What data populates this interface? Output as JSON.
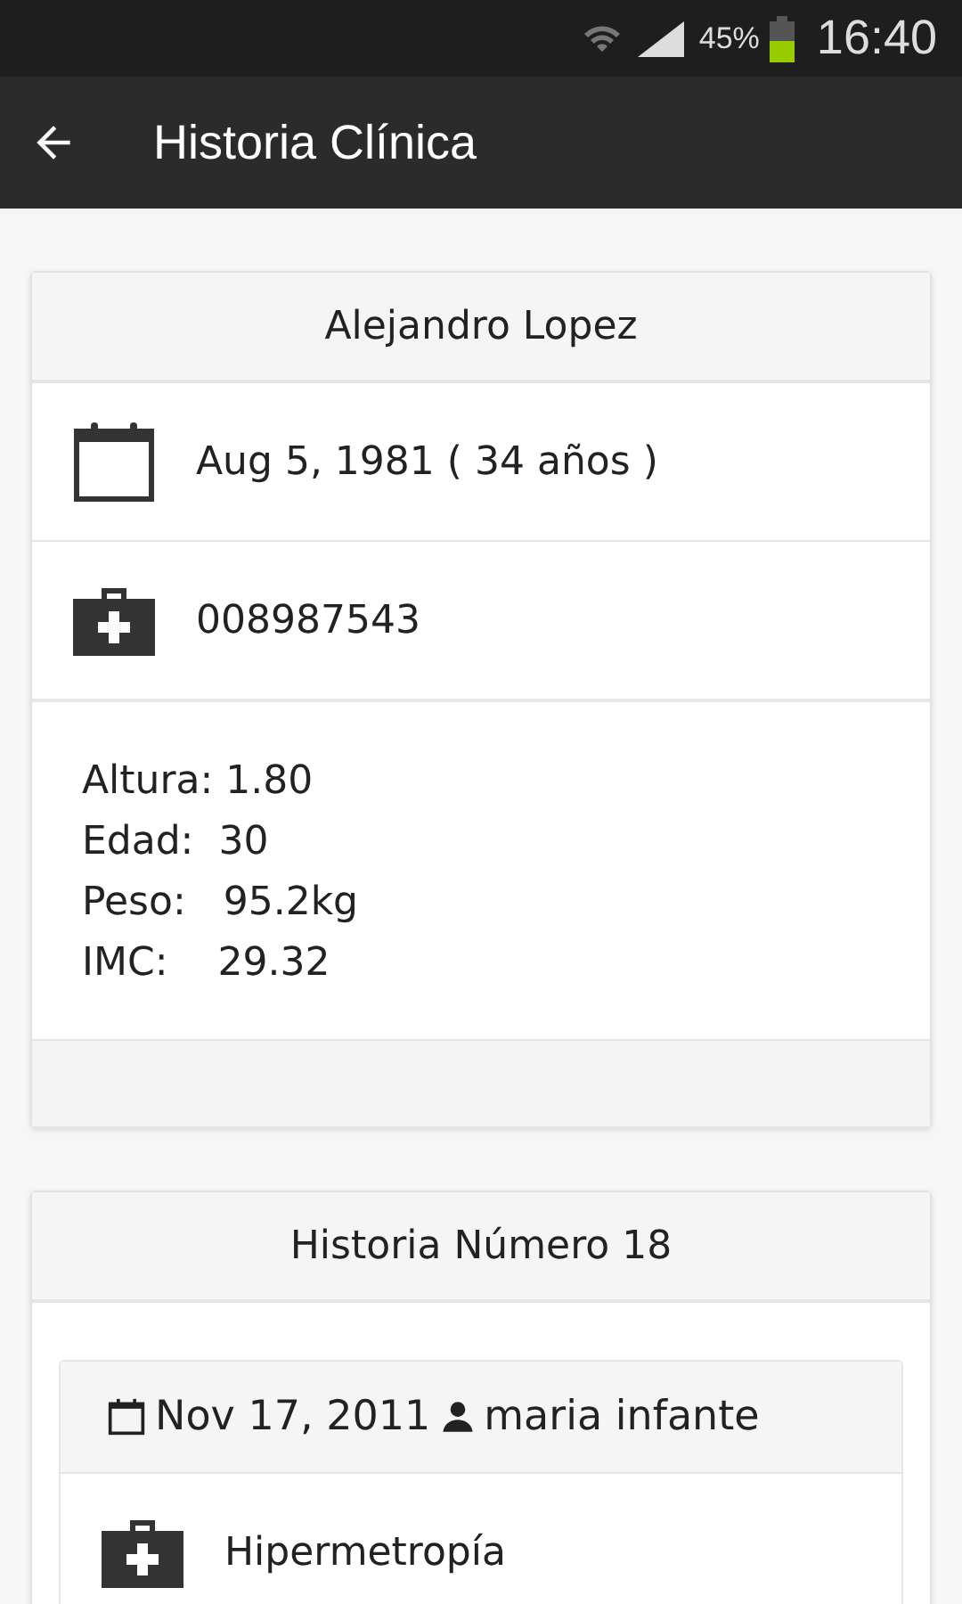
{
  "status_bar": {
    "battery": "45%",
    "time": "16:40"
  },
  "app_bar": {
    "title": "Historia Clínica"
  },
  "patient": {
    "name": "Alejandro Lopez",
    "birth": "Aug 5, 1981 ( 34 años )",
    "record_number": "008987543",
    "stats": [
      "Altura: 1.80",
      "Edad:  30",
      "Peso:   95.2kg",
      "IMC:    29.32"
    ]
  },
  "history": {
    "title": "Historia Número 18",
    "entries": [
      {
        "date": "Nov 17, 2011",
        "author": "maria infante",
        "diagnosis": "Hipermetropía"
      }
    ]
  }
}
